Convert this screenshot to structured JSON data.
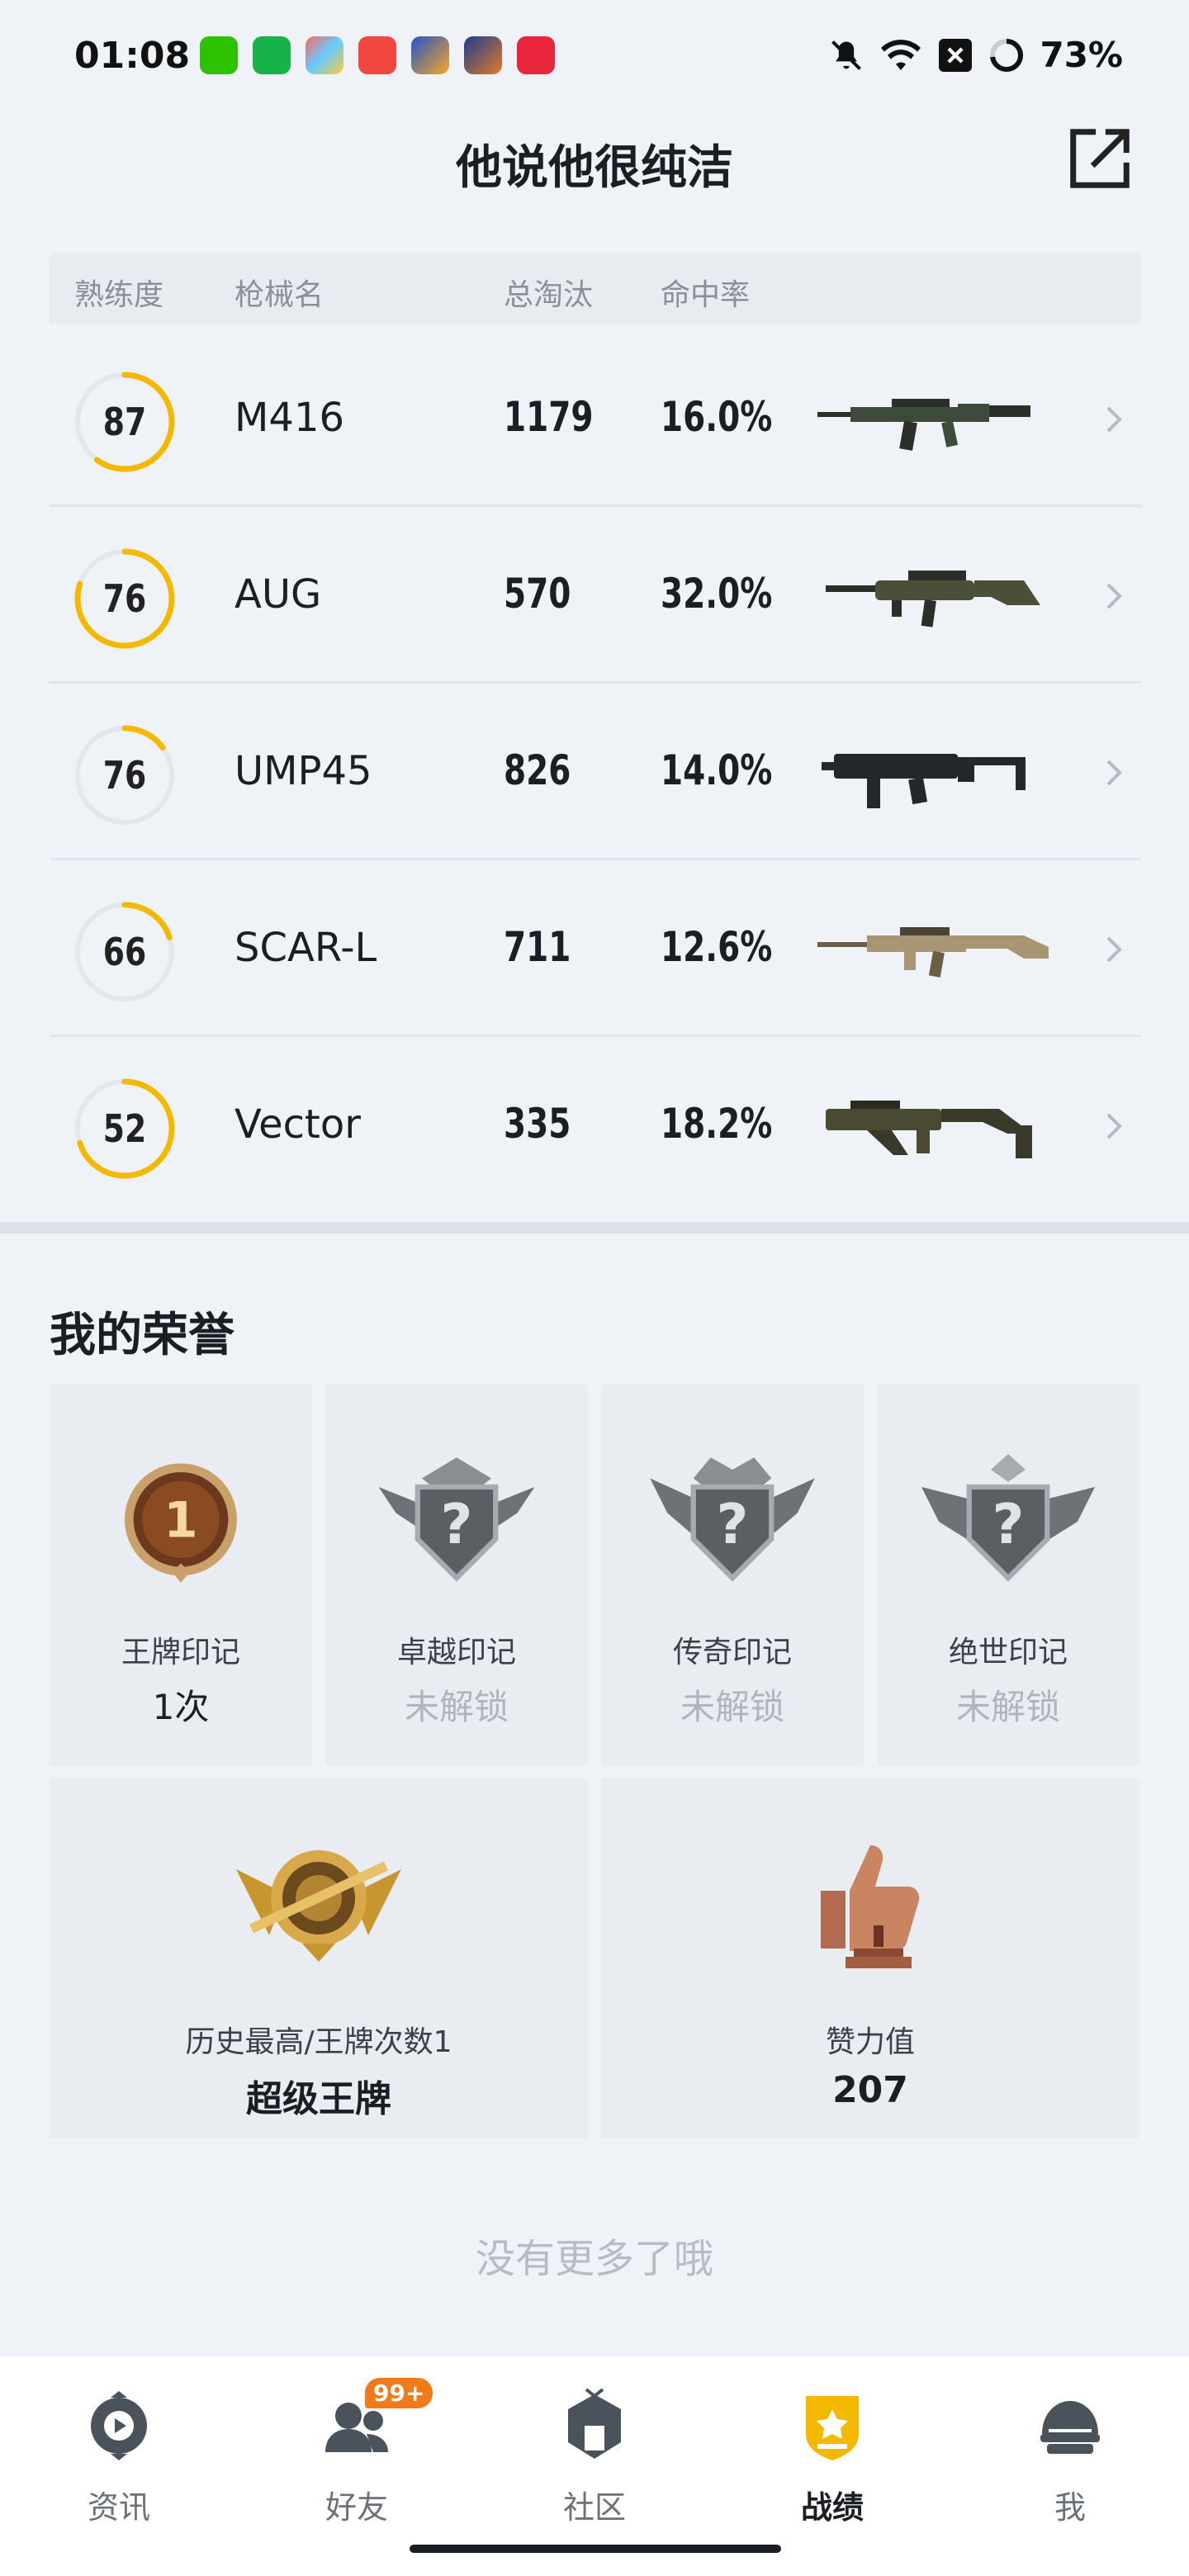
{
  "status_bar": {
    "time": "01:08",
    "battery": "73%"
  },
  "header": {
    "title": "他说他很纯洁"
  },
  "table": {
    "columns": [
      "熟练度",
      "枪械名",
      "总淘汰",
      "命中率"
    ],
    "rows": [
      {
        "proficiency": "87",
        "proficiency_fraction": 0.6,
        "name": "M416",
        "kills": "1179",
        "accuracy": "16.0%"
      },
      {
        "proficiency": "76",
        "proficiency_fraction": 0.8,
        "name": "AUG",
        "kills": "570",
        "accuracy": "32.0%"
      },
      {
        "proficiency": "76",
        "proficiency_fraction": 0.15,
        "name": "UMP45",
        "kills": "826",
        "accuracy": "14.0%"
      },
      {
        "proficiency": "66",
        "proficiency_fraction": 0.2,
        "name": "SCAR-L",
        "kills": "711",
        "accuracy": "12.6%"
      },
      {
        "proficiency": "52",
        "proficiency_fraction": 0.7,
        "name": "Vector",
        "kills": "335",
        "accuracy": "18.2%"
      }
    ]
  },
  "honors": {
    "title": "我的荣誉",
    "badges": [
      {
        "label": "王牌印记",
        "value": "1次",
        "locked": false
      },
      {
        "label": "卓越印记",
        "value": "未解锁",
        "locked": true
      },
      {
        "label": "传奇印记",
        "value": "未解锁",
        "locked": true
      },
      {
        "label": "绝世印记",
        "value": "未解锁",
        "locked": true
      }
    ],
    "highest": {
      "label": "历史最高/王牌次数1",
      "value": "超级王牌"
    },
    "likes": {
      "label": "赞力值",
      "value": "207"
    }
  },
  "footer_text": "没有更多了哦",
  "nav": {
    "items": [
      {
        "label": "资讯",
        "icon": "news-icon"
      },
      {
        "label": "好友",
        "icon": "friends-icon",
        "badge": "99+"
      },
      {
        "label": "社区",
        "icon": "community-icon"
      },
      {
        "label": "战绩",
        "icon": "record-icon",
        "active": true
      },
      {
        "label": "我",
        "icon": "helmet-icon"
      }
    ]
  },
  "colors": {
    "accent": "#f5b800",
    "background": "#eff3f8",
    "badge": "#f27a1a"
  }
}
